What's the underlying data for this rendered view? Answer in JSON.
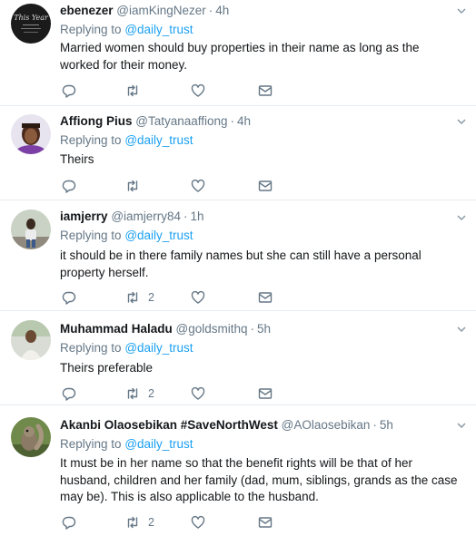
{
  "tweets": [
    {
      "name": "ebenezer",
      "handle": "@iamKingNezer",
      "time": "4h",
      "reply_prefix": "Replying to",
      "reply_to": "@daily_trust",
      "text": "Married women should buy properties in their name as long as the worked for their money.",
      "retweet_count": "",
      "avatar": "avatar-this-year-logo"
    },
    {
      "name": "Affiong Pius",
      "handle": "@Tatyanaaffiong",
      "time": "4h",
      "reply_prefix": "Replying to",
      "reply_to": "@daily_trust",
      "text": "Theirs",
      "retweet_count": "",
      "avatar": "avatar-person-photo"
    },
    {
      "name": "iamjerry",
      "handle": "@iamjerry84",
      "time": "1h",
      "reply_prefix": "Replying to",
      "reply_to": "@daily_trust",
      "text": "it should be in there family names but she can still have a personal property herself.",
      "retweet_count": "2",
      "avatar": "avatar-person-photo"
    },
    {
      "name": "Muhammad Haladu",
      "handle": "@goldsmithq",
      "time": "5h",
      "reply_prefix": "Replying to",
      "reply_to": "@daily_trust",
      "text": "Theirs preferable",
      "retweet_count": "2",
      "avatar": "avatar-person-photo"
    },
    {
      "name": "Akanbi Olaosebikan #SaveNorthWest",
      "handle": "@AOlaosebikan",
      "time": "5h",
      "reply_prefix": "Replying to",
      "reply_to": "@daily_trust",
      "text": "It must be in her name so that the benefit rights will be that of her husband, children and her family (dad, mum, siblings, grands as the case may be). This is also applicable to the husband.",
      "retweet_count": "2",
      "avatar": "avatar-squirrel-photo"
    }
  ],
  "icons": {
    "reply": "reply-icon",
    "retweet": "retweet-icon",
    "like": "heart-icon",
    "message": "envelope-icon",
    "menu": "chevron-down-icon"
  },
  "colors": {
    "link": "#1da1f2",
    "secondary_text": "#657786",
    "divider": "#e6ecf0"
  }
}
